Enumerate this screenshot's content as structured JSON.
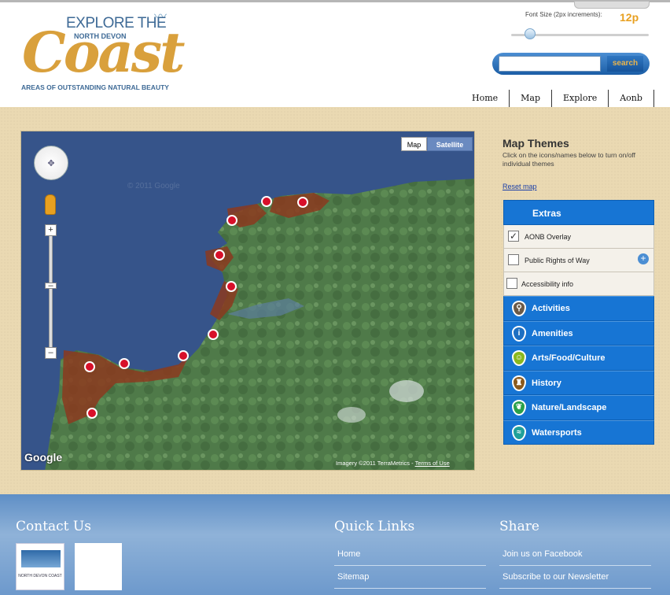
{
  "header": {
    "logo": {
      "explore": "EXPLORE THE",
      "north_devon": "NORTH DEVON",
      "coast": "Coast",
      "tagline": "AREAS OF OUTSTANDING NATURAL BEAUTY"
    },
    "font_size_label": "Font Size (2px increments):",
    "font_size_value": "12p",
    "font_slider_level": 0.15,
    "search_placeholder": "",
    "search_button": "search",
    "nav": [
      "Home",
      "Map",
      "Explore",
      "Aonb"
    ]
  },
  "map": {
    "type_buttons": {
      "map": "Map",
      "satellite": "Satellite"
    },
    "selected_type": "Satellite",
    "google_logo": "Google",
    "imagery_credit": "Imagery ©2011 TerraMetrics - ",
    "terms_link": "Terms of Use",
    "watermark": "© 2011 Google",
    "marker_color": "#d8102a",
    "aonb_color": "#8b3a1f"
  },
  "themes": {
    "title": "Map Themes",
    "description": "Click on the icons/names below to turn on/off individual themes",
    "reset": "Reset map",
    "extras_heading": "Extras",
    "extras": [
      {
        "label": "AONB Overlay",
        "checked": true
      },
      {
        "label": "Public Rights of Way",
        "checked": false
      },
      {
        "label": "Accessibility info",
        "checked": false
      }
    ],
    "items": [
      {
        "label": "Activities",
        "icon": "hiker-icon",
        "color": "#6b5a48"
      },
      {
        "label": "Amenities",
        "icon": "info-icon",
        "color": "#1d6fc2"
      },
      {
        "label": "Arts/Food/Culture",
        "icon": "culture-icon",
        "color": "#8ab81e"
      },
      {
        "label": "History",
        "icon": "castle-icon",
        "color": "#8a5a1e"
      },
      {
        "label": "Nature/Landscape",
        "icon": "leaf-icon",
        "color": "#2aa04a"
      },
      {
        "label": "Watersports",
        "icon": "wave-icon",
        "color": "#1fa09a"
      }
    ]
  },
  "footer": {
    "contact_heading": "Contact Us",
    "quick_links_heading": "Quick Links",
    "share_heading": "Share",
    "logo1_caption": "NORTH DEVON COAST",
    "quick_links": [
      "Home",
      "Sitemap"
    ],
    "share_links": [
      "Join us on Facebook",
      "Subscribe to our Newsletter"
    ]
  }
}
